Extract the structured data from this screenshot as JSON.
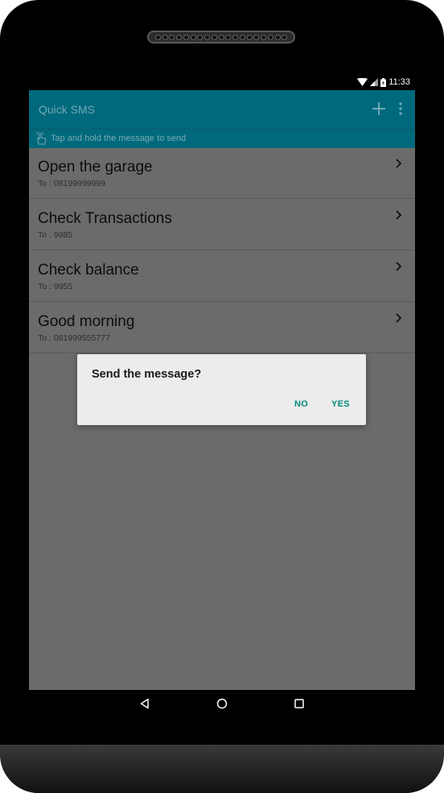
{
  "status_bar": {
    "time": "11:33",
    "icons": [
      "wifi-icon",
      "signal-icon",
      "battery-icon"
    ]
  },
  "app_bar": {
    "title": "Quick SMS",
    "actions": [
      "add-icon",
      "overflow-menu-icon"
    ]
  },
  "hint": {
    "icon": "touch-hand-icon",
    "text": "Tap and hold the message to send"
  },
  "messages": [
    {
      "title": "Open the garage",
      "to": "To : 08199999999"
    },
    {
      "title": "Check Transactions",
      "to": "To : 9985"
    },
    {
      "title": "Check balance",
      "to": "To : 9955"
    },
    {
      "title": "Good morning",
      "to": "To : 081999555777"
    }
  ],
  "dialog": {
    "message": "Send the message?",
    "no_label": "NO",
    "yes_label": "YES"
  },
  "nav": {
    "buttons": [
      "back-icon",
      "home-icon",
      "recents-icon"
    ]
  },
  "colors": {
    "app_bar": "#00697c",
    "dialog_button": "#00897b",
    "dim_overlay": "#6b6b6b"
  }
}
